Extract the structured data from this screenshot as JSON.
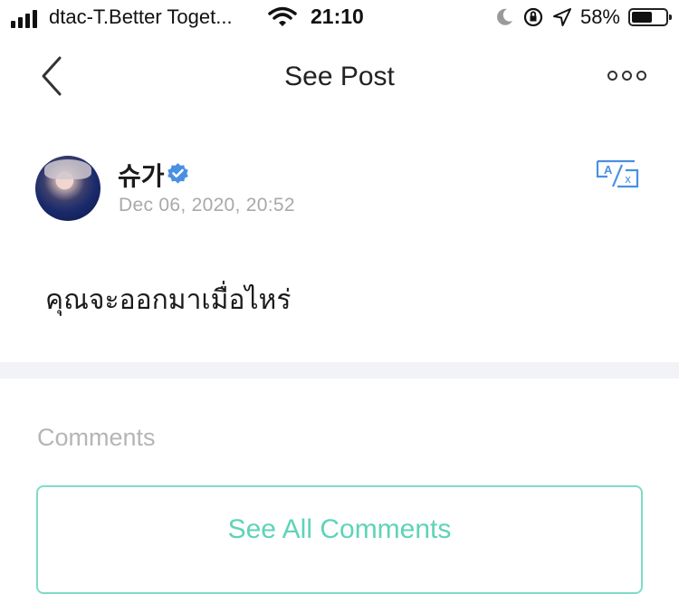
{
  "status_bar": {
    "carrier": "dtac-T.Better Toget...",
    "time": "21:10",
    "battery_percent": "58%",
    "battery_level": 0.58,
    "icons": [
      "signal-icon",
      "wifi-icon",
      "moon-icon",
      "orientation-lock-icon",
      "location-icon",
      "battery-icon"
    ]
  },
  "nav": {
    "title": "See Post",
    "back_icon": "chevron-left-icon",
    "more_icon": "more-icon"
  },
  "post": {
    "author": "슈가",
    "verified": true,
    "date": "Dec 06, 2020, 20:52",
    "body": "คุณจะออกมาเมื่อไหร่",
    "translate_icon": "translate-icon"
  },
  "comments": {
    "heading": "Comments",
    "see_all_label": "See All Comments"
  },
  "colors": {
    "accent": "#5fd3b8",
    "accent_border": "#7fdcc7",
    "verified_blue": "#4a90e2",
    "muted_text": "#a9a9a9",
    "divider": "#f2f3f7"
  }
}
